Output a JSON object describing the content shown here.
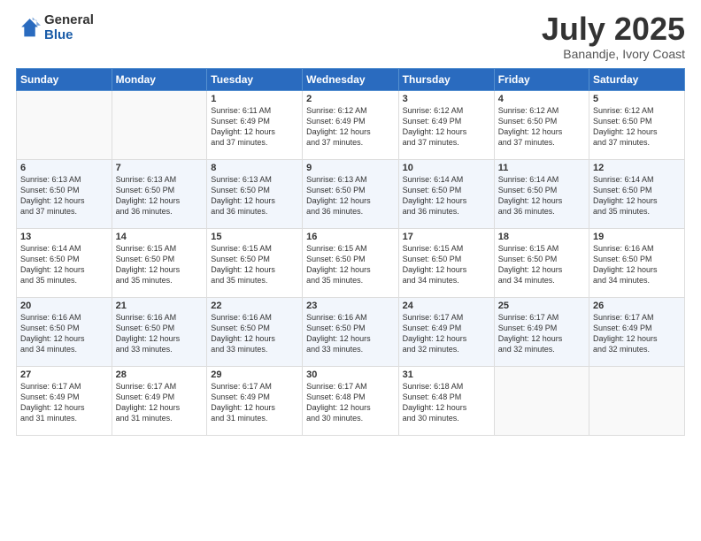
{
  "logo": {
    "general": "General",
    "blue": "Blue"
  },
  "header": {
    "month": "July 2025",
    "location": "Banandje, Ivory Coast"
  },
  "weekdays": [
    "Sunday",
    "Monday",
    "Tuesday",
    "Wednesday",
    "Thursday",
    "Friday",
    "Saturday"
  ],
  "weeks": [
    [
      {
        "day": "",
        "sunrise": "",
        "sunset": "",
        "daylight": ""
      },
      {
        "day": "",
        "sunrise": "",
        "sunset": "",
        "daylight": ""
      },
      {
        "day": "1",
        "sunrise": "Sunrise: 6:11 AM",
        "sunset": "Sunset: 6:49 PM",
        "daylight": "Daylight: 12 hours and 37 minutes."
      },
      {
        "day": "2",
        "sunrise": "Sunrise: 6:12 AM",
        "sunset": "Sunset: 6:49 PM",
        "daylight": "Daylight: 12 hours and 37 minutes."
      },
      {
        "day": "3",
        "sunrise": "Sunrise: 6:12 AM",
        "sunset": "Sunset: 6:49 PM",
        "daylight": "Daylight: 12 hours and 37 minutes."
      },
      {
        "day": "4",
        "sunrise": "Sunrise: 6:12 AM",
        "sunset": "Sunset: 6:50 PM",
        "daylight": "Daylight: 12 hours and 37 minutes."
      },
      {
        "day": "5",
        "sunrise": "Sunrise: 6:12 AM",
        "sunset": "Sunset: 6:50 PM",
        "daylight": "Daylight: 12 hours and 37 minutes."
      }
    ],
    [
      {
        "day": "6",
        "sunrise": "Sunrise: 6:13 AM",
        "sunset": "Sunset: 6:50 PM",
        "daylight": "Daylight: 12 hours and 37 minutes."
      },
      {
        "day": "7",
        "sunrise": "Sunrise: 6:13 AM",
        "sunset": "Sunset: 6:50 PM",
        "daylight": "Daylight: 12 hours and 36 minutes."
      },
      {
        "day": "8",
        "sunrise": "Sunrise: 6:13 AM",
        "sunset": "Sunset: 6:50 PM",
        "daylight": "Daylight: 12 hours and 36 minutes."
      },
      {
        "day": "9",
        "sunrise": "Sunrise: 6:13 AM",
        "sunset": "Sunset: 6:50 PM",
        "daylight": "Daylight: 12 hours and 36 minutes."
      },
      {
        "day": "10",
        "sunrise": "Sunrise: 6:14 AM",
        "sunset": "Sunset: 6:50 PM",
        "daylight": "Daylight: 12 hours and 36 minutes."
      },
      {
        "day": "11",
        "sunrise": "Sunrise: 6:14 AM",
        "sunset": "Sunset: 6:50 PM",
        "daylight": "Daylight: 12 hours and 36 minutes."
      },
      {
        "day": "12",
        "sunrise": "Sunrise: 6:14 AM",
        "sunset": "Sunset: 6:50 PM",
        "daylight": "Daylight: 12 hours and 35 minutes."
      }
    ],
    [
      {
        "day": "13",
        "sunrise": "Sunrise: 6:14 AM",
        "sunset": "Sunset: 6:50 PM",
        "daylight": "Daylight: 12 hours and 35 minutes."
      },
      {
        "day": "14",
        "sunrise": "Sunrise: 6:15 AM",
        "sunset": "Sunset: 6:50 PM",
        "daylight": "Daylight: 12 hours and 35 minutes."
      },
      {
        "day": "15",
        "sunrise": "Sunrise: 6:15 AM",
        "sunset": "Sunset: 6:50 PM",
        "daylight": "Daylight: 12 hours and 35 minutes."
      },
      {
        "day": "16",
        "sunrise": "Sunrise: 6:15 AM",
        "sunset": "Sunset: 6:50 PM",
        "daylight": "Daylight: 12 hours and 35 minutes."
      },
      {
        "day": "17",
        "sunrise": "Sunrise: 6:15 AM",
        "sunset": "Sunset: 6:50 PM",
        "daylight": "Daylight: 12 hours and 34 minutes."
      },
      {
        "day": "18",
        "sunrise": "Sunrise: 6:15 AM",
        "sunset": "Sunset: 6:50 PM",
        "daylight": "Daylight: 12 hours and 34 minutes."
      },
      {
        "day": "19",
        "sunrise": "Sunrise: 6:16 AM",
        "sunset": "Sunset: 6:50 PM",
        "daylight": "Daylight: 12 hours and 34 minutes."
      }
    ],
    [
      {
        "day": "20",
        "sunrise": "Sunrise: 6:16 AM",
        "sunset": "Sunset: 6:50 PM",
        "daylight": "Daylight: 12 hours and 34 minutes."
      },
      {
        "day": "21",
        "sunrise": "Sunrise: 6:16 AM",
        "sunset": "Sunset: 6:50 PM",
        "daylight": "Daylight: 12 hours and 33 minutes."
      },
      {
        "day": "22",
        "sunrise": "Sunrise: 6:16 AM",
        "sunset": "Sunset: 6:50 PM",
        "daylight": "Daylight: 12 hours and 33 minutes."
      },
      {
        "day": "23",
        "sunrise": "Sunrise: 6:16 AM",
        "sunset": "Sunset: 6:50 PM",
        "daylight": "Daylight: 12 hours and 33 minutes."
      },
      {
        "day": "24",
        "sunrise": "Sunrise: 6:17 AM",
        "sunset": "Sunset: 6:49 PM",
        "daylight": "Daylight: 12 hours and 32 minutes."
      },
      {
        "day": "25",
        "sunrise": "Sunrise: 6:17 AM",
        "sunset": "Sunset: 6:49 PM",
        "daylight": "Daylight: 12 hours and 32 minutes."
      },
      {
        "day": "26",
        "sunrise": "Sunrise: 6:17 AM",
        "sunset": "Sunset: 6:49 PM",
        "daylight": "Daylight: 12 hours and 32 minutes."
      }
    ],
    [
      {
        "day": "27",
        "sunrise": "Sunrise: 6:17 AM",
        "sunset": "Sunset: 6:49 PM",
        "daylight": "Daylight: 12 hours and 31 minutes."
      },
      {
        "day": "28",
        "sunrise": "Sunrise: 6:17 AM",
        "sunset": "Sunset: 6:49 PM",
        "daylight": "Daylight: 12 hours and 31 minutes."
      },
      {
        "day": "29",
        "sunrise": "Sunrise: 6:17 AM",
        "sunset": "Sunset: 6:49 PM",
        "daylight": "Daylight: 12 hours and 31 minutes."
      },
      {
        "day": "30",
        "sunrise": "Sunrise: 6:17 AM",
        "sunset": "Sunset: 6:48 PM",
        "daylight": "Daylight: 12 hours and 30 minutes."
      },
      {
        "day": "31",
        "sunrise": "Sunrise: 6:18 AM",
        "sunset": "Sunset: 6:48 PM",
        "daylight": "Daylight: 12 hours and 30 minutes."
      },
      {
        "day": "",
        "sunrise": "",
        "sunset": "",
        "daylight": ""
      },
      {
        "day": "",
        "sunrise": "",
        "sunset": "",
        "daylight": ""
      }
    ]
  ]
}
